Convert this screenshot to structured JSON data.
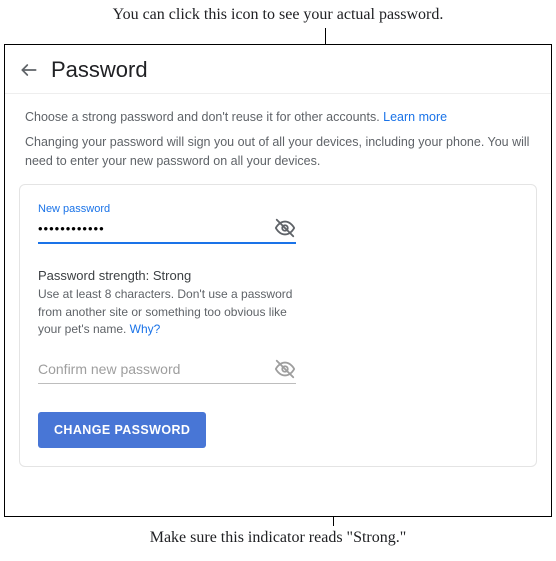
{
  "annotations": {
    "top": "You can click this icon to see your actual password.",
    "bottom": "Make sure this indicator reads \"Strong.\""
  },
  "header": {
    "title": "Password"
  },
  "intro": {
    "line1_prefix": "Choose a strong password and don't reuse it for other accounts. ",
    "learn_more": "Learn more",
    "line2": "Changing your password will sign you out of all your devices, including your phone. You will need to enter your new password on all your devices."
  },
  "form": {
    "new_password_label": "New password",
    "new_password_value": "••••••••••••",
    "strength_label": "Password strength: ",
    "strength_value": "Strong",
    "hint_prefix": "Use at least 8 characters. Don't use a password from another site or something too obvious like your pet's name. ",
    "why_link": "Why?",
    "confirm_placeholder": "Confirm new password",
    "submit_label": "CHANGE PASSWORD"
  }
}
